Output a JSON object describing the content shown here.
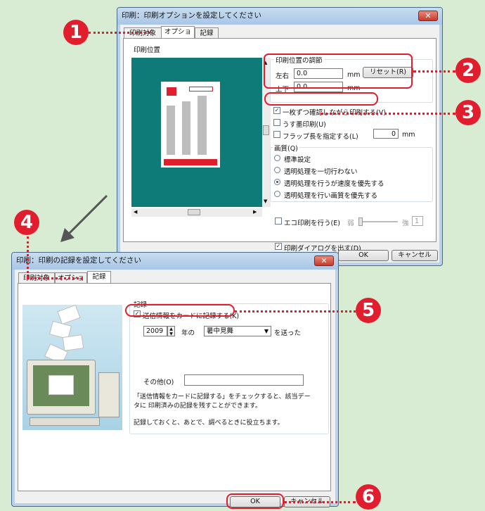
{
  "print_dialog": {
    "title": "印刷：印刷オプションを設定してください",
    "close_glyph": "✕",
    "tabs": [
      "印刷対象",
      "オプション",
      "記録"
    ],
    "print_position_label": "印刷位置",
    "adjust_group_label": "印刷位置の調節",
    "horizontal_label": "左右",
    "horizontal_value": "0.0",
    "vertical_label": "上下",
    "vertical_value": "0.0",
    "unit_mm": "mm",
    "reset_button": "リセット(R)",
    "confirm_each_label": "一枚ずつ確認しながら印刷する(V)",
    "light_ink_label": "うす墨印刷(U)",
    "flap_label": "フラップ長を指定する(L)",
    "flap_value": "0",
    "quality_group_label": "画質(Q)",
    "quality_options": [
      "標準設定",
      "透明処理を一切行わない",
      "透明処理を行うが速度を優先する",
      "透明処理を行い画質を優先する"
    ],
    "eco_label": "エコ印刷を行う(E)",
    "eco_weak": "弱",
    "eco_strong": "強",
    "eco_value": "1",
    "show_dialog_label": "印刷ダイアログを出す(D)",
    "ok_button": "OK",
    "cancel_button": "キャンセル"
  },
  "record_dialog": {
    "title": "印刷：印刷の記録を設定してください",
    "close_glyph": "✕",
    "tabs": [
      "印刷対象",
      "オプション",
      "記録"
    ],
    "record_group_label": "記録",
    "record_checkbox_label": "送信情報をカードに記録する(K)",
    "year_value": "2009",
    "year_suffix": "年の",
    "card_type_value": "暑中見舞",
    "sent_label": "を送った",
    "other_label": "その他(O)",
    "other_value": "",
    "help_text_1": "「送信情報をカードに記録する」をチェックすると、該当データに 印刷済みの記録を残すことができます。",
    "help_text_2": "記録しておくと、あとで、調べるときに役立ちます。",
    "ok_button": "OK",
    "cancel_button": "キャンセル"
  },
  "callouts": [
    "1",
    "2",
    "3",
    "4",
    "5",
    "6"
  ],
  "colors": {
    "accent_red": "#e01e2e",
    "preview_teal": "#0e7b78",
    "background": "#d8ecd4"
  }
}
